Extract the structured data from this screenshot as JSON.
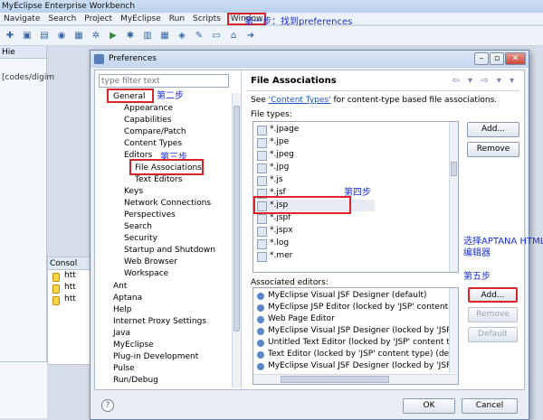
{
  "ide": {
    "title": "MyEclipse Enterprise Workbench",
    "menu": [
      "Navigate",
      "Search",
      "Project",
      "MyEclipse",
      "Run",
      "Scripts",
      "Window"
    ],
    "left_tab": "Hie",
    "left_path": "[codes/digim",
    "console_tab": "Consol",
    "console_lines": [
      "htt",
      "htt",
      "htt"
    ]
  },
  "annotations": {
    "step1": "第一步：找到preferences",
    "step2": "第二步",
    "step3": "第三步",
    "step4": "第四步",
    "step5_note_line1": "选择APTANA HTML",
    "step5_note_line2": "编辑器",
    "step5": "第五步"
  },
  "dialog": {
    "title": "Preferences",
    "filter_placeholder": "type filter text",
    "tree": {
      "general": "General",
      "children": [
        "Appearance",
        "Capabilities",
        "Compare/Patch",
        "Content Types",
        "Editors"
      ],
      "editors_children": [
        "File Associations",
        "Text Editors"
      ],
      "more_children": [
        "Keys",
        "Network Connections",
        "Perspectives",
        "Search",
        "Security",
        "Startup and Shutdown",
        "Web Browser",
        "Workspace"
      ],
      "top_level": [
        "Ant",
        "Aptana",
        "Help",
        "Internet Proxy Settings",
        "Java",
        "MyEclipse",
        "Plug-in Development",
        "Pulse",
        "Run/Debug"
      ]
    },
    "page_title": "File Associations",
    "description_pre": "See ",
    "description_link": "'Content Types'",
    "description_post": " for content-type based file associations.",
    "file_types_label": "File types:",
    "file_types": [
      "*.jpage",
      "*.jpe",
      "*.jpeg",
      "*.jpg",
      "*.js",
      "*.jsf",
      "*.jsp",
      "*.jspf",
      "*.jspx",
      "*.log",
      "*.mer"
    ],
    "buttons": {
      "add": "Add...",
      "remove": "Remove",
      "add2": "Add...",
      "remove2": "Remove",
      "default": "Default"
    },
    "assoc_label": "Associated editors:",
    "editors": [
      "MyEclipse Visual JSF Designer (default)",
      "MyEclipse JSP Editor (locked by 'JSP' content type) (de",
      "Web Page Editor",
      "MyEclipse Visual JSP Designer (locked by 'JSP' conte",
      "Untitled Text Editor (locked by 'JSP' content type) (de",
      "Text Editor (locked by 'JSP' content type) (default fo",
      "MyEclipse Visual JSF Designer (locked by 'JSF Page' co"
    ],
    "footer": {
      "help": "?",
      "ok": "OK",
      "cancel": "Cancel"
    }
  }
}
